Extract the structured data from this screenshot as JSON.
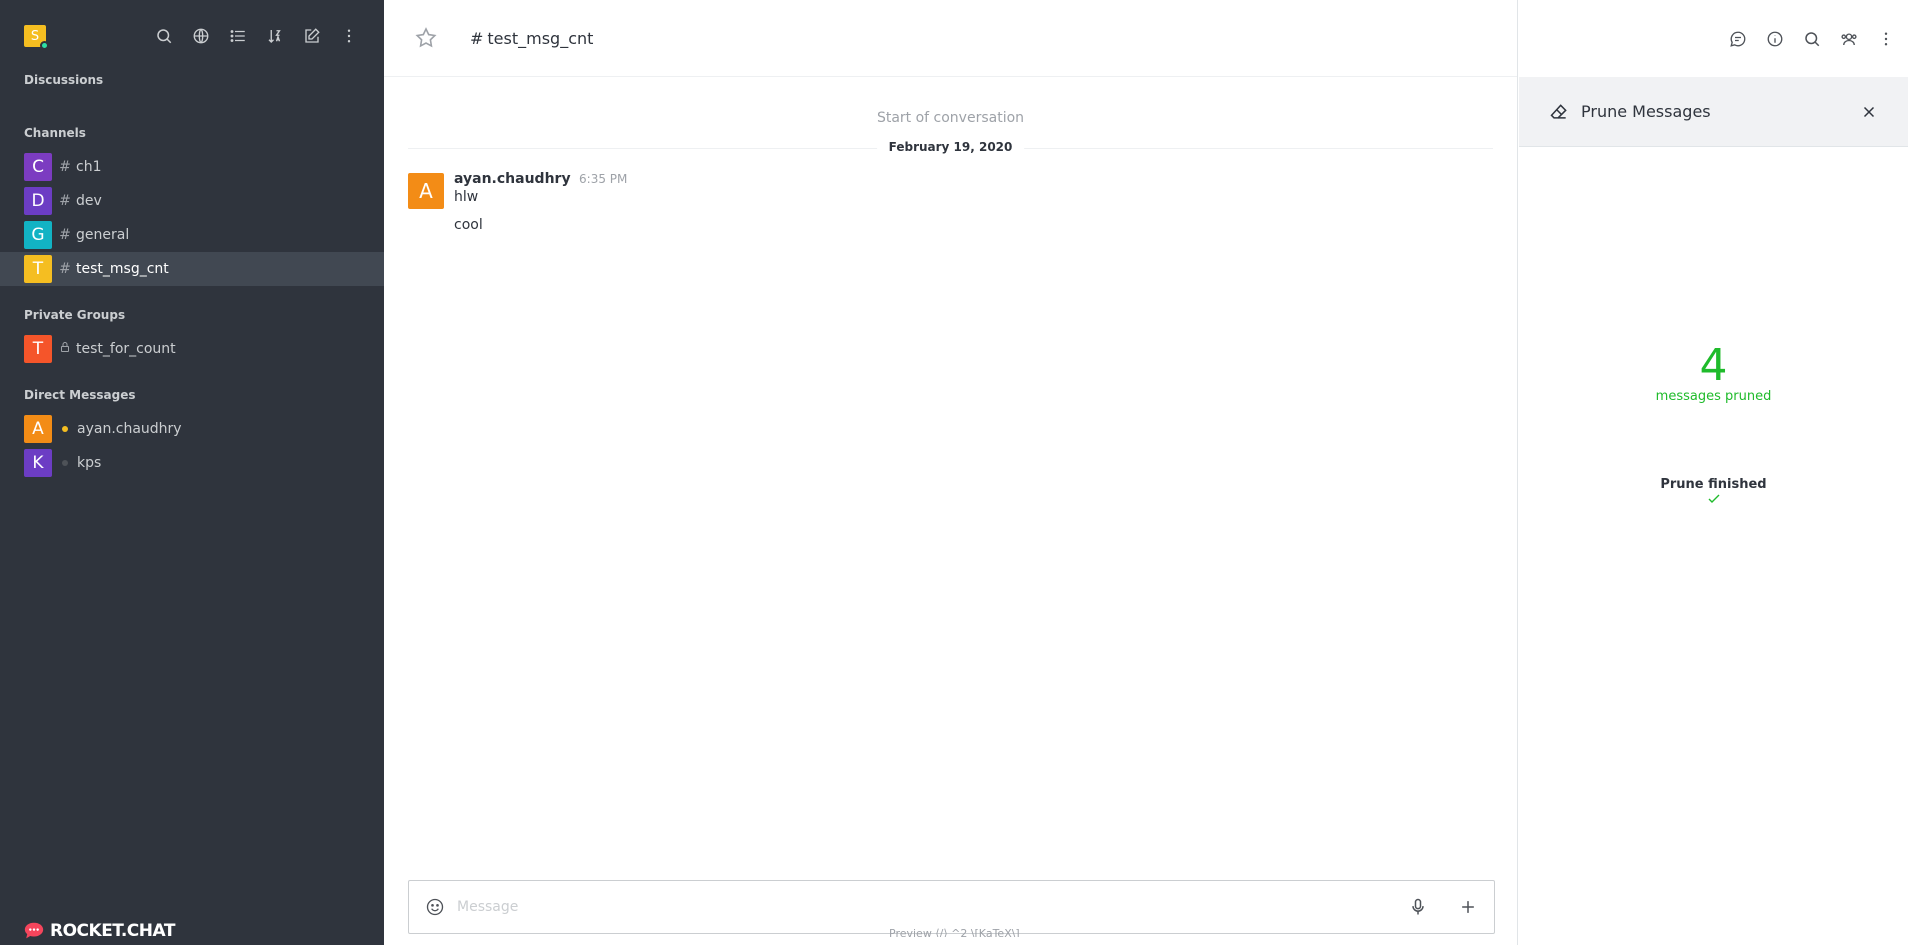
{
  "sidebar": {
    "user_initial": "S",
    "sections": {
      "discussions": "Discussions",
      "channels": "Channels",
      "private_groups": "Private Groups",
      "direct_messages": "Direct Messages"
    },
    "channels": [
      {
        "initial": "C",
        "name": "ch1",
        "color": "#7c3cc1"
      },
      {
        "initial": "D",
        "name": "dev",
        "color": "#6c3dc4"
      },
      {
        "initial": "G",
        "name": "general",
        "color": "#12b3c4"
      },
      {
        "initial": "T",
        "name": "test_msg_cnt",
        "color": "#f5be21",
        "active": true
      }
    ],
    "groups": [
      {
        "initial": "T",
        "name": "test_for_count",
        "color": "#f5552a"
      }
    ],
    "dms": [
      {
        "initial": "A",
        "name": "ayan.chaudhry",
        "color": "#f38c16",
        "status": "#f5be21"
      },
      {
        "initial": "K",
        "name": "kps",
        "color": "#6c3dc4",
        "status": "#9ea2a8"
      }
    ],
    "footer_logo": "ROCKET.CHAT"
  },
  "room": {
    "title": "test_msg_cnt",
    "start": "Start of conversation",
    "date": "February 19, 2020",
    "message": {
      "initial": "A",
      "user": "ayan.chaudhry",
      "time": "6:35 PM",
      "lines": [
        "hlw",
        "cool"
      ]
    },
    "composer_placeholder": "Message",
    "hint": "Preview   ⟨/⟩   ^2   \\[KaTeX\\]"
  },
  "panel": {
    "title": "Prune Messages",
    "count": "4",
    "count_label": "messages pruned",
    "finished": "Prune finished"
  }
}
